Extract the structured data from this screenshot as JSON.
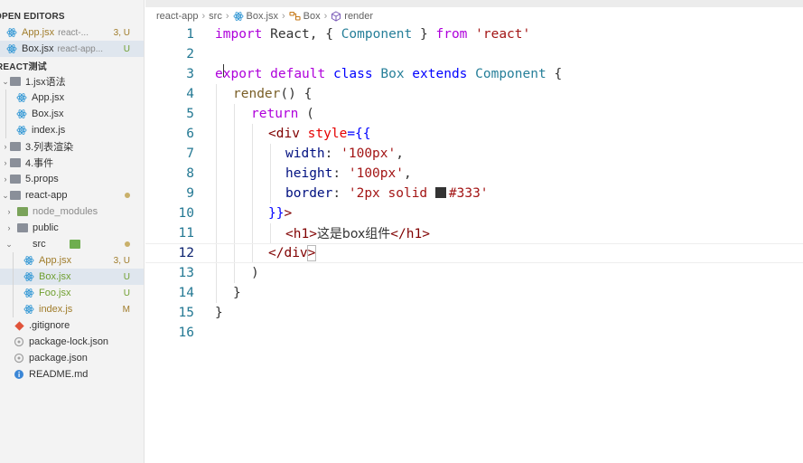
{
  "sidebar": {
    "open_editors": {
      "heading": "OPEN EDITORS",
      "items": [
        {
          "label": "App.jsx",
          "sub": "react-...",
          "badge": "3, U"
        },
        {
          "label": "Box.jsx",
          "sub": "react-app...",
          "badge": "U"
        }
      ]
    },
    "workspace": {
      "heading": "REACT测试",
      "items": [
        {
          "label": "1.jsx语法"
        },
        {
          "label": "App.jsx"
        },
        {
          "label": "Box.jsx"
        },
        {
          "label": "index.js"
        },
        {
          "label": "3.列表渲染"
        },
        {
          "label": "4.事件"
        },
        {
          "label": "5.props"
        },
        {
          "label": "react-app"
        },
        {
          "label": "node_modules"
        },
        {
          "label": "public"
        },
        {
          "label": "src"
        },
        {
          "label": "App.jsx",
          "badge": "3, U"
        },
        {
          "label": "Box.jsx",
          "badge": "U"
        },
        {
          "label": "Foo.jsx",
          "badge": "U"
        },
        {
          "label": "index.js",
          "badge": "M"
        },
        {
          "label": ".gitignore"
        },
        {
          "label": "package-lock.json"
        },
        {
          "label": "package.json"
        },
        {
          "label": "README.md"
        }
      ]
    },
    "colors": {
      "untracked": "#6f9f2f",
      "modified": "#a07c2a",
      "error": "#c05050"
    }
  },
  "breadcrumb": [
    "react-app",
    "src",
    "Box.jsx",
    "Box",
    "render"
  ],
  "editor": {
    "line_numbers": [
      "1",
      "2",
      "3",
      "4",
      "5",
      "6",
      "7",
      "8",
      "9",
      "10",
      "11",
      "12",
      "13",
      "14",
      "15",
      "16"
    ],
    "tokens": {
      "l1": [
        "import",
        " React, { ",
        "Component",
        " } ",
        "from",
        " ",
        "'react'"
      ],
      "l3": [
        "export",
        " ",
        "default",
        " ",
        "class",
        " ",
        "Box",
        " ",
        "extends",
        " ",
        "Component",
        " {"
      ],
      "l4": [
        "render",
        "() {"
      ],
      "l5": [
        "return",
        " ("
      ],
      "l6": [
        "<",
        "div",
        " ",
        "style",
        "={{"
      ],
      "l7": [
        "width",
        ": ",
        "'100px'",
        ","
      ],
      "l8": [
        "height",
        ": ",
        "'100px'",
        ","
      ],
      "l9": [
        "border",
        ": ",
        "'2px solid ",
        "#333'"
      ],
      "l10": [
        "}}",
        ">"
      ],
      "l11": [
        "<",
        "h1",
        ">",
        "这是box组件",
        "</",
        "h1",
        ">"
      ],
      "l12": [
        "</",
        "div",
        ">"
      ],
      "l13": [
        ")"
      ],
      "l14": [
        "}"
      ],
      "l15": [
        "}"
      ]
    }
  }
}
